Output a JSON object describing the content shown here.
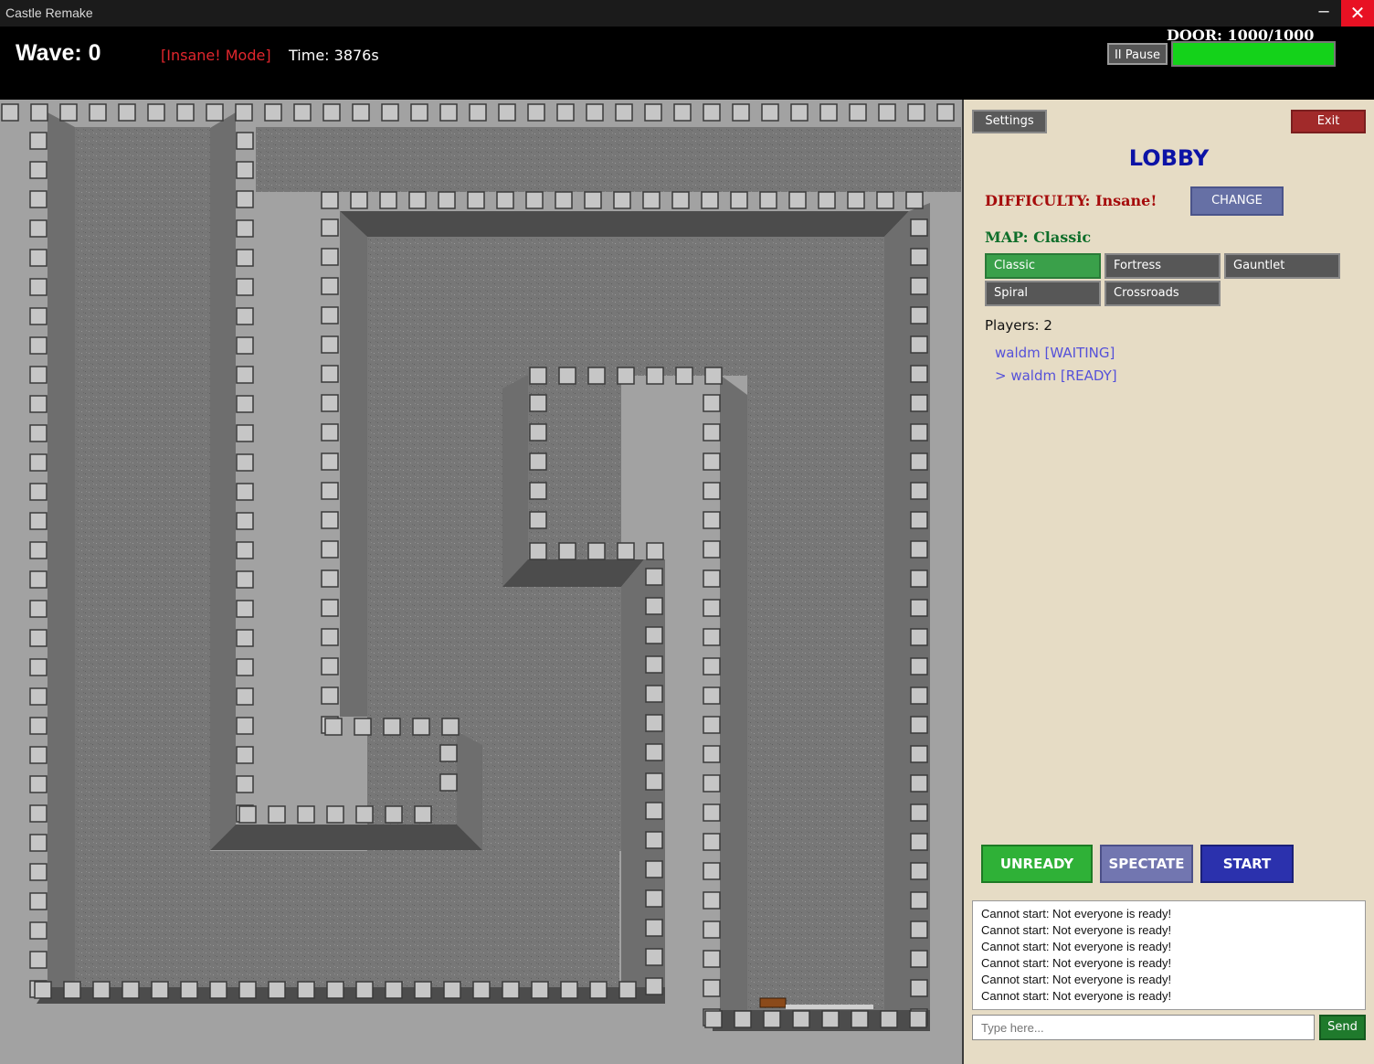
{
  "window": {
    "title": "Castle Remake",
    "minimize_glyph": "─",
    "close_glyph": "✕"
  },
  "hud": {
    "wave": "Wave: 0",
    "mode": "[Insane! Mode]",
    "time": "Time: 3876s",
    "door_label": "DOOR: 1000/1000",
    "door_fraction": 1.0,
    "pause_label": "II Pause",
    "colors": {
      "door_bar": "#14d21a",
      "mode": "#e2262d"
    }
  },
  "panel": {
    "settings_label": "Settings",
    "exit_label": "Exit",
    "lobby_title": "LOBBY",
    "difficulty": "DIFFICULTY: Insane!",
    "change_label": "CHANGE",
    "map_label": "MAP: Classic",
    "maps": [
      "Classic",
      "Fortress",
      "Gauntlet",
      "Spiral",
      "Crossroads"
    ],
    "selected_map": "Classic",
    "players_label": "Players: 2",
    "players": [
      "waldm [WAITING]",
      "> waldm [READY]"
    ],
    "unready_label": "UNREADY",
    "spectate_label": "SPECTATE",
    "start_label": "START",
    "log": [
      "Cannot start: Not everyone is ready!",
      "Cannot start: Not everyone is ready!",
      "Cannot start: Not everyone is ready!",
      "Cannot start: Not everyone is ready!",
      "Cannot start: Not everyone is ready!",
      "Cannot start: Not everyone is ready!"
    ],
    "chat_placeholder": "Type here...",
    "send_label": "Send"
  }
}
